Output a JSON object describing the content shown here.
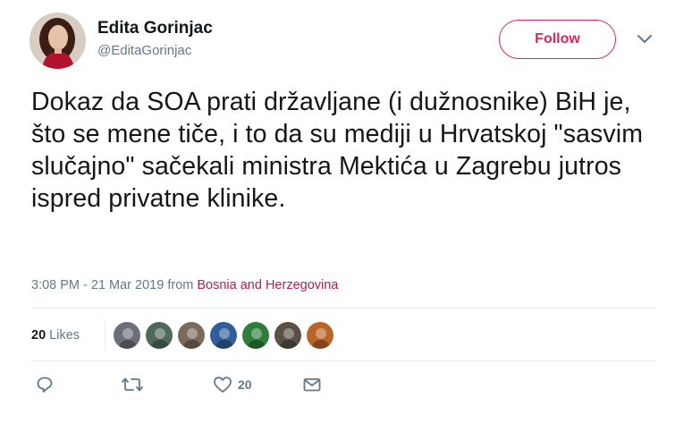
{
  "author": {
    "name": "Edita Gorinjac",
    "handle": "@EditaGorinjac"
  },
  "follow_label": "Follow",
  "tweet_text": "Dokaz da SOA prati državljane (i dužnosnike) BiH je, što se mene tiče, i to da su mediji u Hrvatskoj \"sasvim slučajno\" sačekali ministra Mektića u Zagrebu jutros ispred privatne klinike.",
  "timestamp": "3:08 PM - 21 Mar 2019",
  "from_label": "from",
  "location": "Bosnia and Herzegovina",
  "likes": {
    "count": "20",
    "label": "Likes"
  },
  "liker_avatars": [
    {
      "name": "liker-avatar-1",
      "color": "#6b6f78"
    },
    {
      "name": "liker-avatar-2",
      "color": "#4f6a5a"
    },
    {
      "name": "liker-avatar-3",
      "color": "#7a6a5c"
    },
    {
      "name": "liker-avatar-4",
      "color": "#2e5f9a"
    },
    {
      "name": "liker-avatar-5",
      "color": "#2f7d3a"
    },
    {
      "name": "liker-avatar-6",
      "color": "#5a5046"
    },
    {
      "name": "liker-avatar-7",
      "color": "#b9652a"
    }
  ],
  "actions": {
    "reply_icon": "reply-icon",
    "retweet_icon": "retweet-icon",
    "like_icon": "heart-icon",
    "like_count": "20",
    "dm_icon": "envelope-icon"
  },
  "colors": {
    "follow_accent": "#e0245e",
    "location_link": "#b0214f",
    "secondary_text": "#657786"
  }
}
